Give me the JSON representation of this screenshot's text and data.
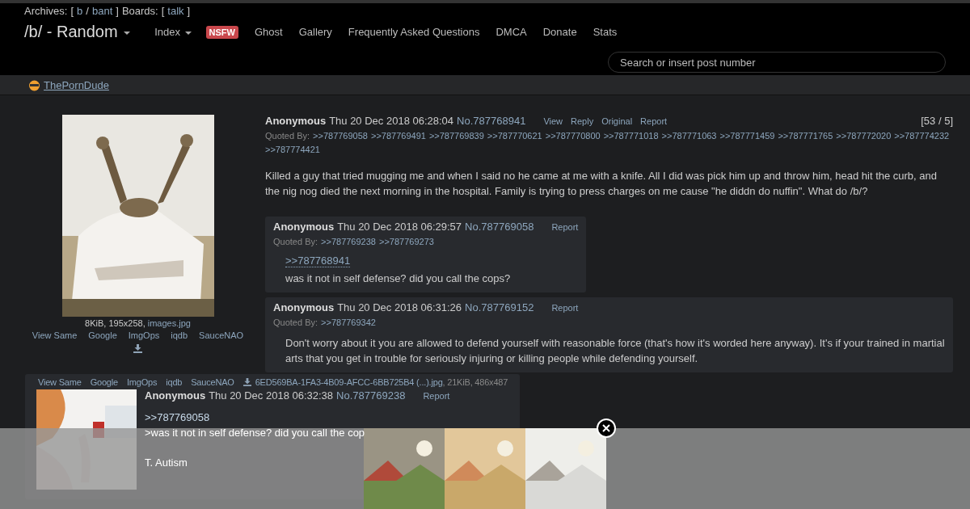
{
  "archives": {
    "label": "Archives:",
    "open": "[",
    "links": [
      "b",
      "bant"
    ],
    "separator": "/",
    "close": "]",
    "boards_label": "Boards:",
    "boards": [
      "talk"
    ]
  },
  "board_title": "/b/ - Random",
  "nav": [
    {
      "label": "Index",
      "kind": "dropdown"
    },
    {
      "label": "NSFW",
      "kind": "badge"
    },
    {
      "label": "Ghost",
      "kind": "link"
    },
    {
      "label": "Gallery",
      "kind": "link"
    },
    {
      "label": "Frequently Asked Questions",
      "kind": "link"
    },
    {
      "label": "DMCA",
      "kind": "link"
    },
    {
      "label": "Donate",
      "kind": "link"
    },
    {
      "label": "Stats",
      "kind": "link"
    }
  ],
  "search": {
    "placeholder": "Search or insert post number"
  },
  "sponsor": {
    "label": "ThePornDude"
  },
  "op": {
    "file_info": "8KiB, 195x258,",
    "file_name": "images.jpg",
    "image_links": [
      "View Same",
      "Google",
      "ImgOps",
      "iqdb",
      "SauceNAO"
    ],
    "name": "Anonymous",
    "date": "Thu 20 Dec 2018 06:28:04",
    "number": "No.787768941",
    "actions": [
      "View",
      "Reply",
      "Original",
      "Report"
    ],
    "counts": "[53 / 5]",
    "quoted_by_label": "Quoted By:",
    "quoted_by": [
      ">>787769058",
      ">>787769491",
      ">>787769839",
      ">>787770621",
      ">>787770800",
      ">>787771018",
      ">>787771063",
      ">>787771459",
      ">>787771765",
      ">>787772020",
      ">>787774232",
      ">>787774421"
    ],
    "text": "Killed a guy that tried mugging me and when I said no he came at me with a knife. All I did was pick him up and throw him, head hit the curb, and the nig nog died the next morning in the hospital. Family is trying to press charges on me cause \"he diddn do nuffin\". What do /b/?"
  },
  "replies": [
    {
      "name": "Anonymous",
      "date": "Thu 20 Dec 2018 06:29:57",
      "number": "No.787769058",
      "action": "Report",
      "quoted_by_label": "Quoted By:",
      "quoted_by": [
        ">>787769238",
        ">>787769273"
      ],
      "quote_link": ">>787768941",
      "lines": [
        "was it not in self defense? did you call the cops?"
      ]
    },
    {
      "name": "Anonymous",
      "date": "Thu 20 Dec 2018 06:31:26",
      "number": "No.787769152",
      "action": "Report",
      "quoted_by_label": "Quoted By:",
      "quoted_by": [
        ">>787769342"
      ],
      "lines": [
        "Don't worry about it you are allowed to defend yourself with reasonable force (that's how it's worded here anyway). It's if your trained in martial arts that you get in trouble for seriously injuring or killing people while defending yourself."
      ]
    }
  ],
  "image_reply": {
    "image_links": [
      "View Same",
      "Google",
      "ImgOps",
      "iqdb",
      "SauceNAO"
    ],
    "file_name": "6ED569BA-1FA3-4B09-AFCC-6BB725B4 (...).jpg",
    "file_info": ", 21KiB, 486x487",
    "name": "Anonymous",
    "date": "Thu 20 Dec 2018 06:32:38",
    "number": "No.787769238",
    "action": "Report",
    "quote_link": ">>787769058",
    "greentext": ">was it not in self defense? did you call the cop",
    "text": "T. Autism"
  }
}
